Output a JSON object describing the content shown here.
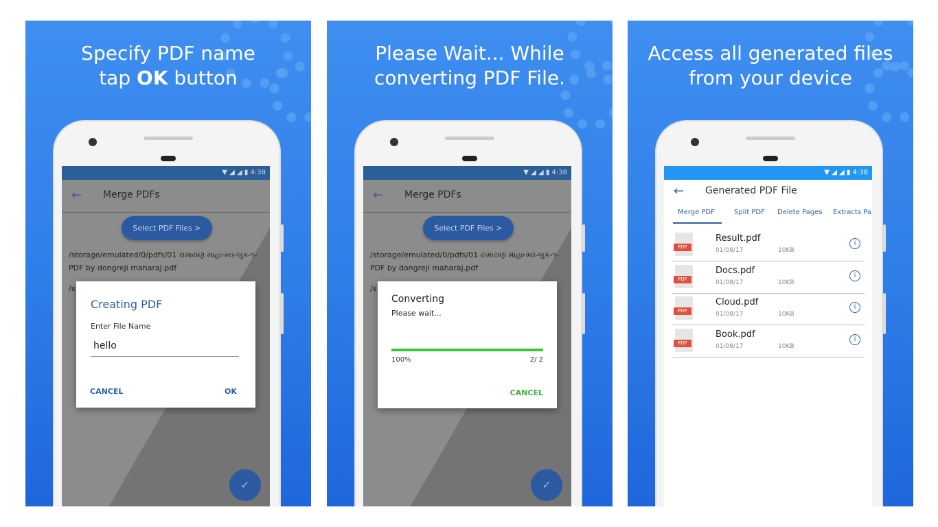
{
  "colors": {
    "background_blue": "#2f7de8",
    "accent": "#2c63b8",
    "status_bar": "#2196f3",
    "progress": "#3cc33c",
    "pdf_red": "#e0503c"
  },
  "status": {
    "time": "4:38"
  },
  "panels": [
    {
      "headline_line1": "Specify PDF name",
      "headline_line2_prefix": "tap ",
      "headline_line2_bold": "OK",
      "headline_line2_suffix": " button",
      "toolbar_title": "Merge PDFs",
      "select_button": "Select PDF Files  >",
      "path_text": "/storage/emulated/0/pdfs/01 રામાયણ માહાત્મ્ય-બુક-૧-PDF by dongreji maharaj.pdf",
      "path_text_2": "/s",
      "dialog": {
        "title": "Creating PDF",
        "label": "Enter File Name",
        "value": "hello",
        "cancel": "CANCEL",
        "ok": "OK"
      }
    },
    {
      "headline_line1": "Please Wait... While",
      "headline_line2": "converting PDF File.",
      "toolbar_title": "Merge PDFs",
      "select_button": "Select PDF Files  >",
      "path_text": "/storage/emulated/0/pdfs/01 રામાયણ માહાત્મ્ય-બુક-૧-PDF by dongreji maharaj.pdf",
      "path_text_2": "/s",
      "dialog": {
        "title": "Converting",
        "subtitle": "Please wait...",
        "progress_percent": "100%",
        "progress_value": 1.0,
        "count": "2/ 2",
        "cancel": "CANCEL"
      }
    },
    {
      "headline_line1": "Access all generated files",
      "headline_line2": "from your device",
      "toolbar_title": "Generated PDF File",
      "tabs": [
        "Merge PDF",
        "Split PDF",
        "Delete Pages",
        "Extracts Pa"
      ],
      "active_tab": "Merge PDF",
      "files": [
        {
          "name": "Result.pdf",
          "date": "01/08/17",
          "size": "10KB",
          "icon_label": "PDF"
        },
        {
          "name": "Docs.pdf",
          "date": "01/08/17",
          "size": "10KB",
          "icon_label": "PDF"
        },
        {
          "name": "Cloud.pdf",
          "date": "01/08/17",
          "size": "10KB",
          "icon_label": "PDF"
        },
        {
          "name": "Book.pdf",
          "date": "01/08/17",
          "size": "10KB",
          "icon_label": "PDF"
        }
      ]
    }
  ],
  "icons": {
    "back": "arrow-left-icon",
    "fab": "check-icon",
    "info": "info-icon",
    "file": "pdf-file-icon",
    "decor": "gear-icon"
  }
}
